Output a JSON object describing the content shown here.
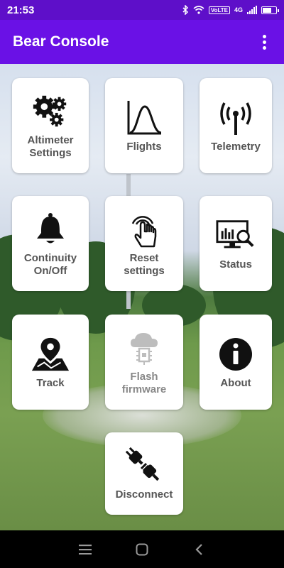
{
  "status_bar": {
    "time": "21:53",
    "network": "4G",
    "volte": "VoLTE",
    "battery_level": 0.7
  },
  "app_bar": {
    "title": "Bear Console",
    "menu_icon": "more-vertical-icon"
  },
  "tiles": [
    {
      "label": "Altimeter\nSettings",
      "icon": "gears-icon",
      "enabled": true
    },
    {
      "label": "Flights",
      "icon": "bell-curve-chart-icon",
      "enabled": true
    },
    {
      "label": "Telemetry",
      "icon": "antenna-icon",
      "enabled": true
    },
    {
      "label": "Continuity\nOn/Off",
      "icon": "bell-icon",
      "enabled": true
    },
    {
      "label": "Reset\nsettings",
      "icon": "touch-hand-icon",
      "enabled": true
    },
    {
      "label": "Status",
      "icon": "monitor-search-icon",
      "enabled": true
    },
    {
      "label": "Track",
      "icon": "map-pin-icon",
      "enabled": true
    },
    {
      "label": "Flash\nfirmware",
      "icon": "cloud-chip-icon",
      "enabled": false
    },
    {
      "label": "About",
      "icon": "info-icon",
      "enabled": true
    },
    {
      "label": "Disconnect",
      "icon": "plug-disconnect-icon",
      "enabled": true
    }
  ],
  "nav_bar": {
    "items": [
      "menu-icon",
      "home-icon",
      "back-icon"
    ]
  },
  "colors": {
    "status_bar": "#5e0fc9",
    "app_bar": "#6a11e6",
    "tile_bg": "#ffffff",
    "tile_text": "#555555"
  }
}
